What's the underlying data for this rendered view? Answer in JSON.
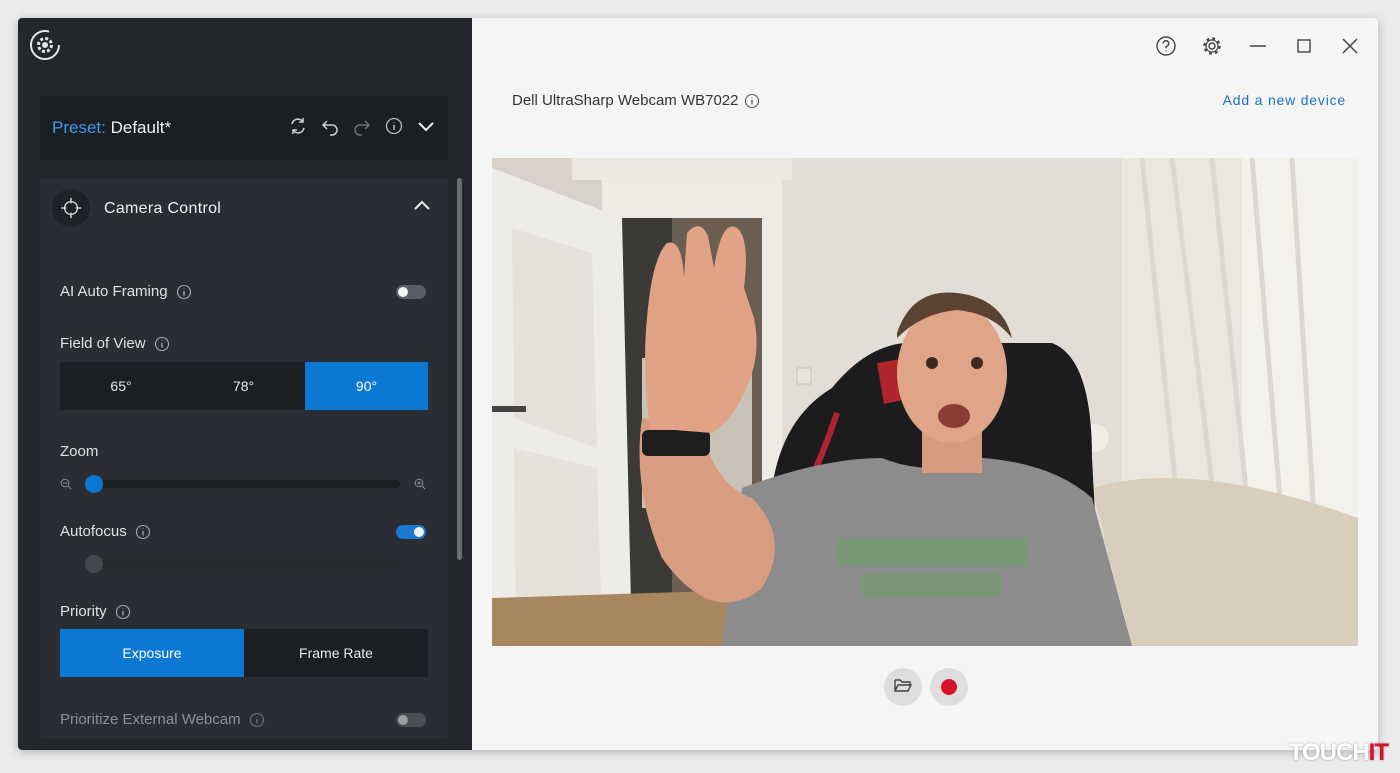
{
  "sidebar": {
    "preset": {
      "key": "Preset:",
      "value": "Default*"
    },
    "section": {
      "title": "Camera Control"
    },
    "ai_auto_framing": {
      "label": "AI Auto Framing",
      "enabled": false
    },
    "field_of_view": {
      "label": "Field of View",
      "options": [
        "65°",
        "78°",
        "90°"
      ],
      "selected": "90°"
    },
    "zoom": {
      "label": "Zoom",
      "value": 0.0
    },
    "autofocus": {
      "label": "Autofocus",
      "enabled": true,
      "focus_value": 0.0
    },
    "priority": {
      "label": "Priority",
      "options": [
        "Exposure",
        "Frame Rate"
      ],
      "selected": "Exposure"
    },
    "prioritize_external": {
      "label": "Prioritize External Webcam",
      "enabled": false
    }
  },
  "main": {
    "device_name": "Dell UltraSharp Webcam WB7022",
    "add_device_label": "Add a new device"
  },
  "watermark": {
    "main": "TOUCH",
    "accent": "IT"
  },
  "colors": {
    "accent": "#0b78d3",
    "record": "#d6112a",
    "sidebar_bg": "#23272c"
  }
}
